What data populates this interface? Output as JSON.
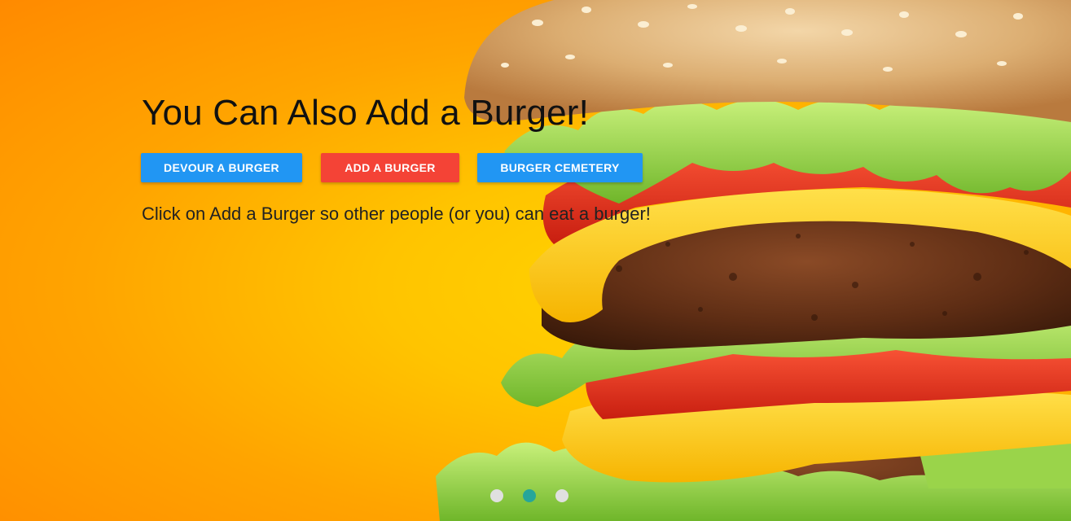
{
  "carousel": {
    "slide": {
      "title": "You Can Also Add a Burger!",
      "subtitle": "Click on Add a Burger so other people (or you) can eat a burger!",
      "image": "burger-photo"
    },
    "buttons": {
      "devour_label": "DEVOUR A BURGER",
      "add_label": "ADD A BURGER",
      "cemetery_label": "BURGER CEMETERY"
    },
    "indicators": {
      "count": 3,
      "active_index": 1
    }
  },
  "colors": {
    "background_edge": "#ff8a00",
    "background_center": "#ffd400",
    "button_blue": "#2196f3",
    "button_red": "#f44336",
    "indicator_active": "#26a69a",
    "indicator_inactive": "#e0e0e0"
  }
}
